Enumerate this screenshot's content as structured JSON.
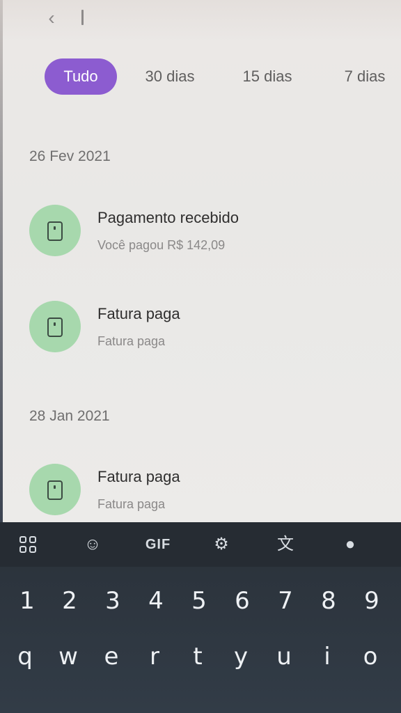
{
  "header": {
    "back_icon": "chevron-left-icon"
  },
  "filters": {
    "all": "Tudo",
    "d30": "30 dias",
    "d15": "15 dias",
    "d7": "7 dias"
  },
  "colors": {
    "accent": "#8c5cd0",
    "icon_bg": "#a7d8ad"
  },
  "groups": [
    {
      "date": "26 Fev 2021",
      "items": [
        {
          "title": "Pagamento recebido",
          "subtitle": "Você pagou R$ 142,09",
          "icon": "phone-icon"
        },
        {
          "title": "Fatura paga",
          "subtitle": "Fatura paga",
          "icon": "phone-icon"
        }
      ]
    },
    {
      "date": "28 Jan 2021",
      "items": [
        {
          "title": "Fatura paga",
          "subtitle": "Fatura paga",
          "icon": "phone-icon"
        }
      ]
    }
  ],
  "keyboard": {
    "toolbar": {
      "grid": "apps-grid-icon",
      "sticker": "sticker-icon",
      "gif": "GIF",
      "settings": "gear-icon",
      "translate": "translate-icon",
      "theme": "palette-icon"
    },
    "numbers": [
      "1",
      "2",
      "3",
      "4",
      "5",
      "6",
      "7",
      "8",
      "9"
    ],
    "letters": [
      "q",
      "w",
      "e",
      "r",
      "t",
      "y",
      "u",
      "i",
      "o"
    ]
  }
}
